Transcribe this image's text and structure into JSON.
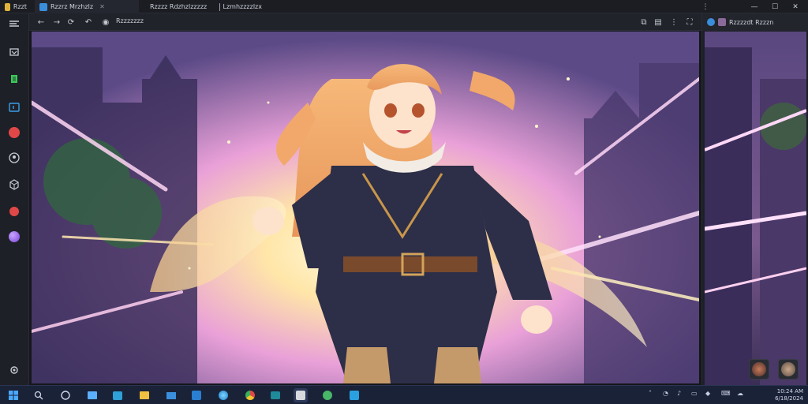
{
  "tabs": [
    {
      "label": "Rzzt",
      "icon": "app-logo-icon",
      "color": "#e0b43c"
    },
    {
      "label": "Rzzrz Mrzhzlz",
      "icon": "browser-icon",
      "color": "#3a8fdc"
    },
    {
      "label": "Rzzzz Rdzhzlzzzzz",
      "icon": "folder-icon",
      "color": "#d39a2a"
    },
    {
      "label": "Lzmhzzzzlzx",
      "icon": "page-icon",
      "color": "#9aa0ab"
    }
  ],
  "window_controls": {
    "minimize": "—",
    "maximize": "☐",
    "close": "✕"
  },
  "toolbar": {
    "title": "Rzzzzzzz",
    "buttons": [
      "back-icon",
      "forward-icon",
      "refresh-icon",
      "settings-icon",
      "share-icon",
      "copy-icon",
      "menu-icon",
      "fullscreen-icon"
    ]
  },
  "left_rail": {
    "items": [
      {
        "icon": "collapse-icon",
        "color": "#c8ccd4"
      },
      {
        "icon": "layers-icon",
        "color": "#c8ccd4"
      },
      {
        "icon": "brush-icon",
        "color": "#3cc85a"
      },
      {
        "icon": "image-icon",
        "color": "#3aa0e8"
      },
      {
        "icon": "record-icon",
        "color": "#e04848"
      },
      {
        "icon": "user-icon",
        "color": "#c8ccd4"
      },
      {
        "icon": "cube-icon",
        "color": "#c8ccd4"
      },
      {
        "icon": "stop-icon",
        "color": "#e04848"
      },
      {
        "icon": "sphere-icon",
        "color": "#9a6ae0"
      },
      {
        "icon": "settings-icon",
        "color": "#c8ccd4"
      }
    ]
  },
  "right_panel": {
    "title": "Rzzzzdt Rzzzn",
    "thumbnails": [
      "character-thumb-1",
      "character-thumb-2"
    ]
  },
  "taskbar": {
    "apps": [
      "start-icon",
      "search-icon",
      "cortana-icon",
      "file-explorer-icon",
      "store-icon",
      "folder-icon",
      "mail-icon",
      "edge-icon",
      "chrome-icon",
      "terminal-icon",
      "app-active-icon",
      "game-icon",
      "photos-icon"
    ],
    "tray_icons": [
      "chevron-up-icon",
      "network-icon",
      "volume-icon",
      "battery-icon",
      "keyboard-icon"
    ],
    "clock_time": "10:24 AM",
    "clock_date": "6/18/2024"
  },
  "colors": {
    "accent": "#3a8fdc",
    "taskbar": "#1a2238",
    "chrome": "#1e2027"
  }
}
